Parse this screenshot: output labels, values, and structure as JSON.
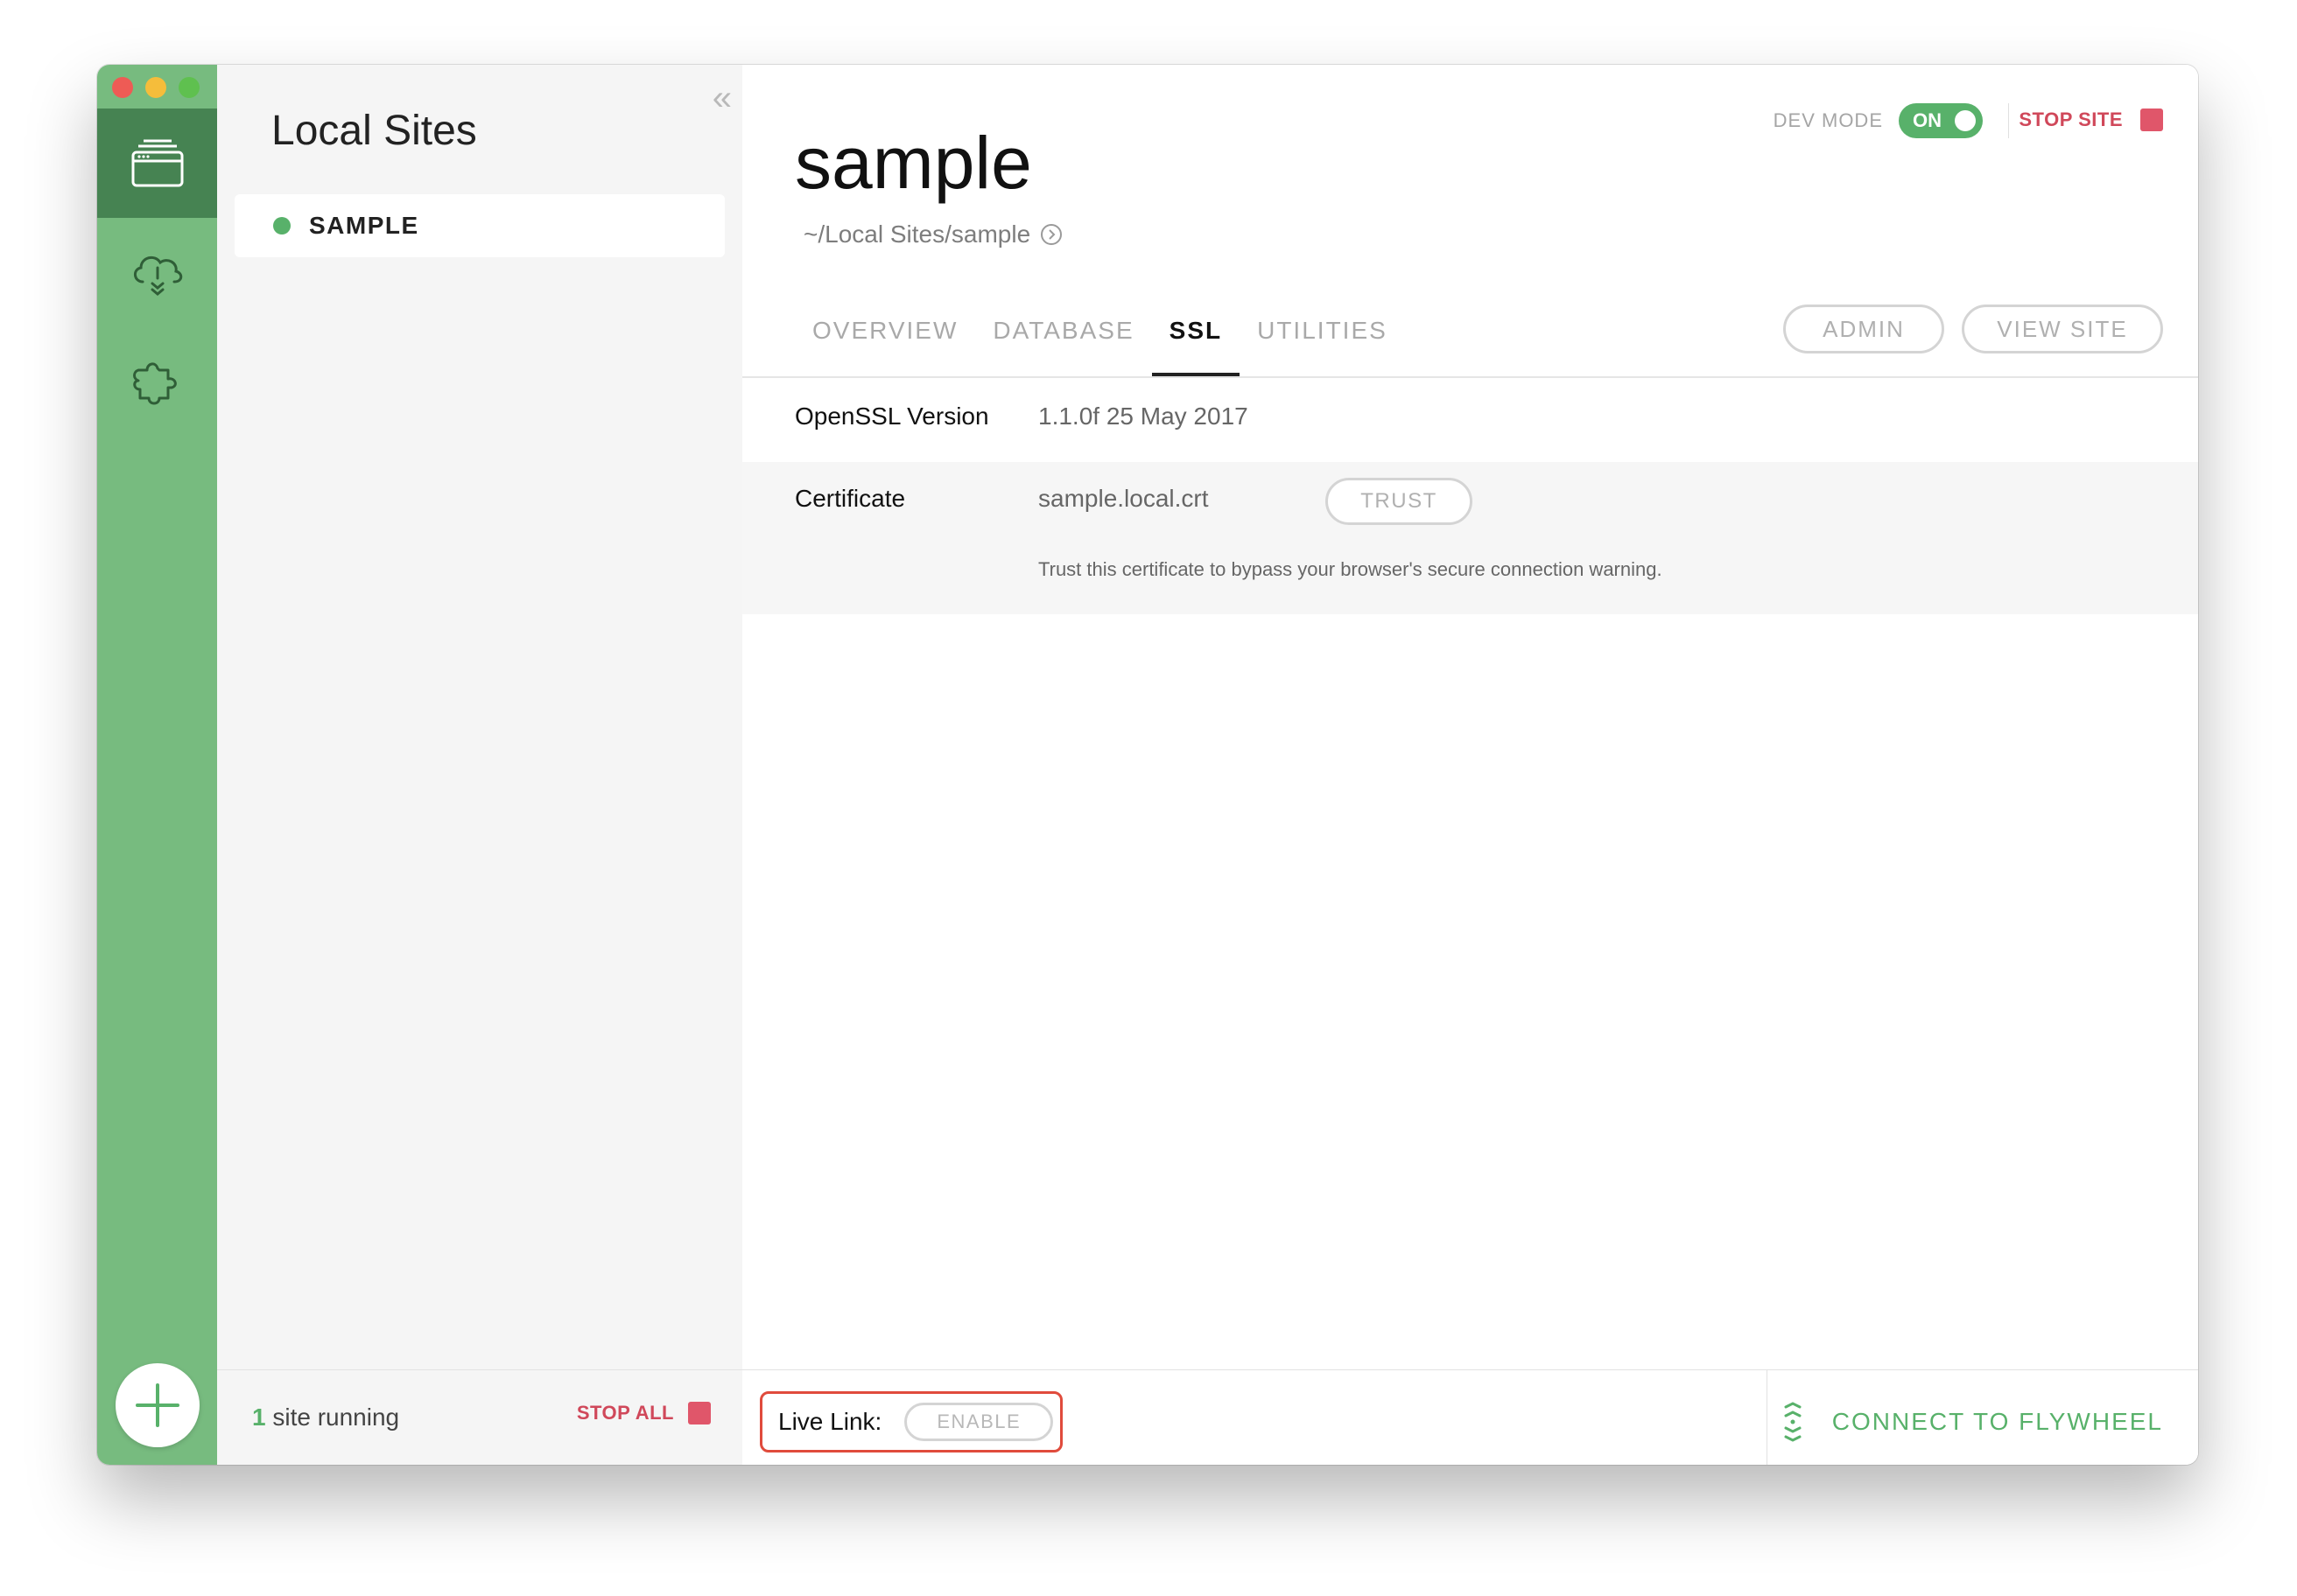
{
  "rail": {
    "items": [
      {
        "icon": "sites-icon"
      },
      {
        "icon": "cloud-icon"
      },
      {
        "icon": "addons-icon"
      }
    ],
    "add_icon": "plus-icon"
  },
  "sidebar": {
    "collapse_icon": "«",
    "title": "Local Sites",
    "sites": [
      {
        "name": "SAMPLE",
        "status_color": "#58b16a"
      }
    ],
    "footer": {
      "running_count": "1",
      "running_text": " site running",
      "stop_all": "STOP ALL"
    }
  },
  "main": {
    "site_title": "sample",
    "site_path": "~/Local Sites/sample",
    "dev_mode_label": "DEV MODE",
    "dev_mode_state": "ON",
    "stop_site": "STOP SITE",
    "tabs": [
      {
        "label": "OVERVIEW"
      },
      {
        "label": "DATABASE"
      },
      {
        "label": "SSL",
        "active": true
      },
      {
        "label": "UTILITIES"
      }
    ],
    "buttons": {
      "admin": "ADMIN",
      "view_site": "VIEW SITE"
    },
    "ssl": {
      "openssl_label": "OpenSSL Version",
      "openssl_value": "1.1.0f  25 May 2017",
      "cert_label": "Certificate",
      "cert_value": "sample.local.crt",
      "trust_button": "TRUST",
      "trust_note": "Trust this certificate to bypass your browser's secure connection warning."
    },
    "footer": {
      "live_link_label": "Live Link:",
      "enable_button": "ENABLE",
      "connect": "CONNECT TO FLYWHEEL"
    }
  },
  "colors": {
    "brand_green": "#77bb7f",
    "rail_active": "#468352",
    "accent_green": "#58b16a",
    "stop_red": "#d0485a",
    "highlight_red": "#e04b3c"
  }
}
